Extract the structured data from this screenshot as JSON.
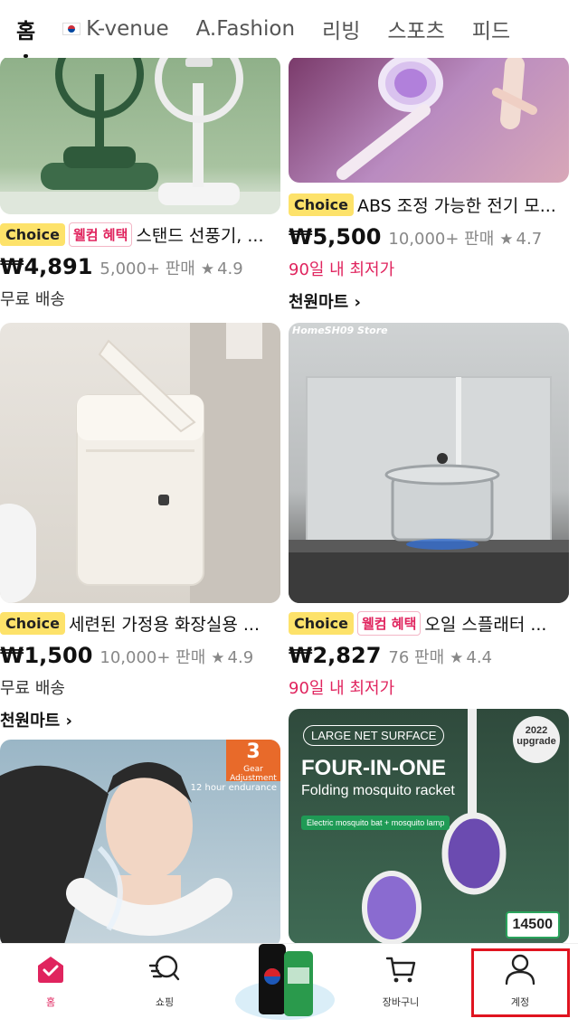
{
  "tabs": [
    {
      "label": "홈",
      "active": true
    },
    {
      "label": "K-venue",
      "flag": true
    },
    {
      "label": "A.Fashion"
    },
    {
      "label": "리빙"
    },
    {
      "label": "스포츠"
    },
    {
      "label": "피드"
    }
  ],
  "products": {
    "p1": {
      "choice": "Choice",
      "welcome": "웰컴 혜택",
      "title": "스탠드 선풍기, ...",
      "price": "₩4,891",
      "sold": "5,000+ 판매",
      "rating": "4.9",
      "extra": "무료 배송"
    },
    "p2": {
      "choice": "Choice",
      "title": "ABS 조정 가능한 전기 모...",
      "price": "₩5,500",
      "sold": "10,000+ 판매",
      "rating": "4.7",
      "extra": "90일 내 최저가",
      "store": "천원마트 ›"
    },
    "p3": {
      "choice": "Choice",
      "title": "세련된 가정용 화장실용 ...",
      "price": "₩1,500",
      "sold": "10,000+ 판매",
      "rating": "4.9",
      "extra": "무료 배송",
      "store": "천원마트 ›"
    },
    "p4": {
      "choice": "Choice",
      "welcome": "웰컴 혜택",
      "title": "오일 스플래터 ...",
      "price": "₩2,827",
      "sold": "76 판매",
      "rating": "4.4",
      "extra": "90일 내 최저가",
      "store_label": "HomeSH09 Store"
    },
    "p5": {
      "promo_num": "3",
      "promo_sub": "Gear Adjustment",
      "promo_sub2": "12 hour endurance"
    },
    "p6": {
      "pill": "LARGE NET SURFACE",
      "title": "FOUR-IN-ONE",
      "sub": "Folding mosquito racket",
      "strip": "Electric mosquito bat + mosquito lamp",
      "year_top": "2022",
      "year_bottom": "upgrade",
      "count": "14500"
    }
  },
  "bottom_nav": [
    {
      "label": "홈",
      "icon": "home-icon",
      "active": true
    },
    {
      "label": "쇼핑",
      "icon": "shopping-search-icon"
    },
    {
      "label": "장바구니",
      "icon": "cart-icon"
    },
    {
      "label": "계정",
      "icon": "account-icon"
    }
  ],
  "colors": {
    "accent": "#e0245e",
    "choice_bg": "#fde26a",
    "highlight": "#e0141f"
  }
}
